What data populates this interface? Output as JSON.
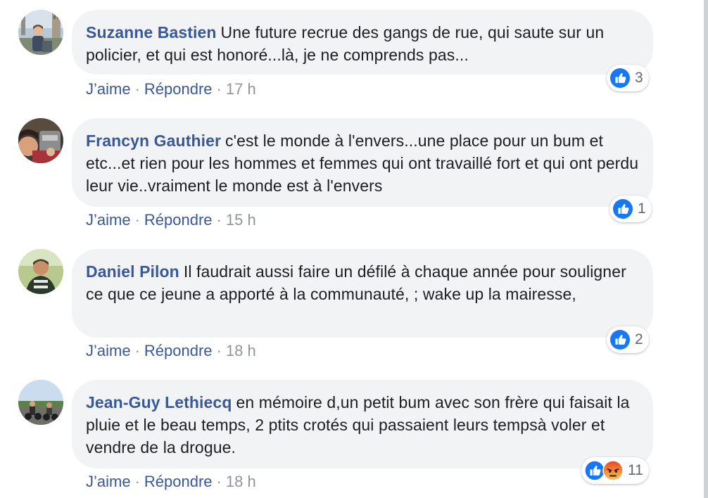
{
  "comments": [
    {
      "author": "Suzanne Bastien",
      "text": "Une future recrue des gangs de rue, qui saute sur un policier, et qui est honoré...là, je ne comprends pas...",
      "like": "J’aime",
      "reply": "Répondre",
      "time": "17 h",
      "reaction_count": "3",
      "reactions": [
        "like-icon"
      ]
    },
    {
      "author": "Francyn Gauthier",
      "text": "c'est le monde à l'envers...une place pour un bum et etc...et rien pour les hommes et femmes qui ont travaillé fort et qui ont perdu leur vie..vraiment le monde est à l'envers",
      "like": "J’aime",
      "reply": "Répondre",
      "time": "15 h",
      "reaction_count": "1",
      "reactions": [
        "like-icon"
      ]
    },
    {
      "author": "Daniel Pilon",
      "text": "Il faudrait aussi faire un défilé à chaque année pour souligner ce que ce jeune a apporté à la communauté, ; wake up la mairesse,",
      "like": "J’aime",
      "reply": "Répondre",
      "time": "18 h",
      "reaction_count": "2",
      "reactions": [
        "like-icon"
      ]
    },
    {
      "author": "Jean-Guy Lethiecq",
      "text": "en mémoire d,un petit bum avec son frère qui faisait la pluie et le beau temps, 2 ptits crotés qui passaient leurs tempsà voler et vendre de la drogue.",
      "like": "J’aime",
      "reply": "Répondre",
      "time": "18 h",
      "reaction_count": "11",
      "reactions": [
        "like-icon",
        "angry-icon"
      ]
    }
  ],
  "colors": {
    "author": "#385898",
    "bubble": "#f2f3f5",
    "like_blue": "#1877f2",
    "angry_red": "#e9451f",
    "meta_gray": "#90949c"
  }
}
